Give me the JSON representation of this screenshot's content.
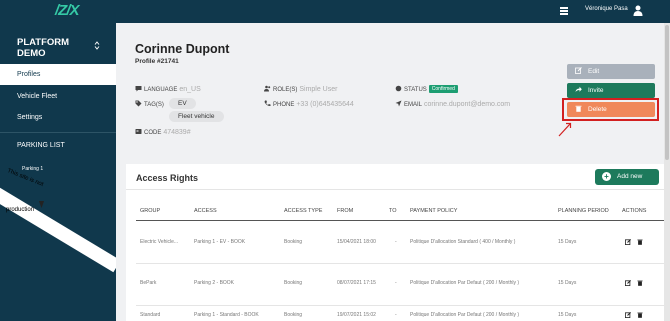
{
  "topbar": {
    "logo": "/Z/X",
    "user_name": "Véronique Pasa"
  },
  "sidebar": {
    "brand": "PLATFORM DEMO",
    "nav": [
      {
        "label": "Profiles",
        "active": true
      },
      {
        "label": "Vehicle Fleet",
        "active": false
      },
      {
        "label": "Settings",
        "active": false
      }
    ],
    "parking_title": "PARKING LIST",
    "parking_item": "Parking 1",
    "ribbon_line1": "This site is not",
    "ribbon_line2": "production"
  },
  "profile": {
    "name": "Corinne Dupont",
    "profile_id": "Profile #21741",
    "language_label": "LANGUAGE",
    "language_value": "en_US",
    "tags_label": "TAG(S)",
    "tags": [
      "EV",
      "Fleet vehicle"
    ],
    "code_label": "CODE",
    "code_value": "474839#",
    "roles_label": "ROLE(S)",
    "roles_value": "Simple User",
    "phone_label": "PHONE",
    "phone_value": "+33 (0)645435644",
    "status_label": "STATUS",
    "status_value": "Confirmed",
    "email_label": "EMAIL",
    "email_value": "corinne.dupont@demo.com"
  },
  "actions": {
    "edit": "Edit",
    "invite": "Invite",
    "delete": "Delete"
  },
  "access_rights": {
    "title": "Access Rights",
    "add_label": "Add new",
    "columns": [
      "GROUP",
      "ACCESS",
      "ACCESS TYPE",
      "FROM",
      "TO",
      "PAYMENT POLICY",
      "PLANNING PERIOD",
      "ACTIONS"
    ],
    "rows": [
      {
        "group": "Electric Vehicle...",
        "access": "Parking 1 - EV - BOOK",
        "type": "Booking",
        "from": "15/04/2021 18:00",
        "to": "-",
        "policy": "Politique D'allocation Standard ( 400 / Monthly )",
        "period": "15 Days"
      },
      {
        "group": "BePark",
        "access": "Parking 2 - BOOK",
        "type": "Booking",
        "from": "08/07/2021 17:15",
        "to": "-",
        "policy": "Politique D'allocation Par Defaut ( 200 / Monthly )",
        "period": "15 Days"
      },
      {
        "group": "Standard",
        "access": "Parking 1 - Standard - BOOK",
        "type": "Booking",
        "from": "19/07/2021 15:02",
        "to": "-",
        "policy": "Politique D'allocation Par Defaut ( 200 / Monthly )",
        "period": "15 Days"
      }
    ]
  },
  "colors": {
    "navy": "#10384c",
    "green": "#1d7a5c",
    "delete": "#f0885a",
    "edit": "#a9b1bb",
    "highlight": "#d22020"
  }
}
